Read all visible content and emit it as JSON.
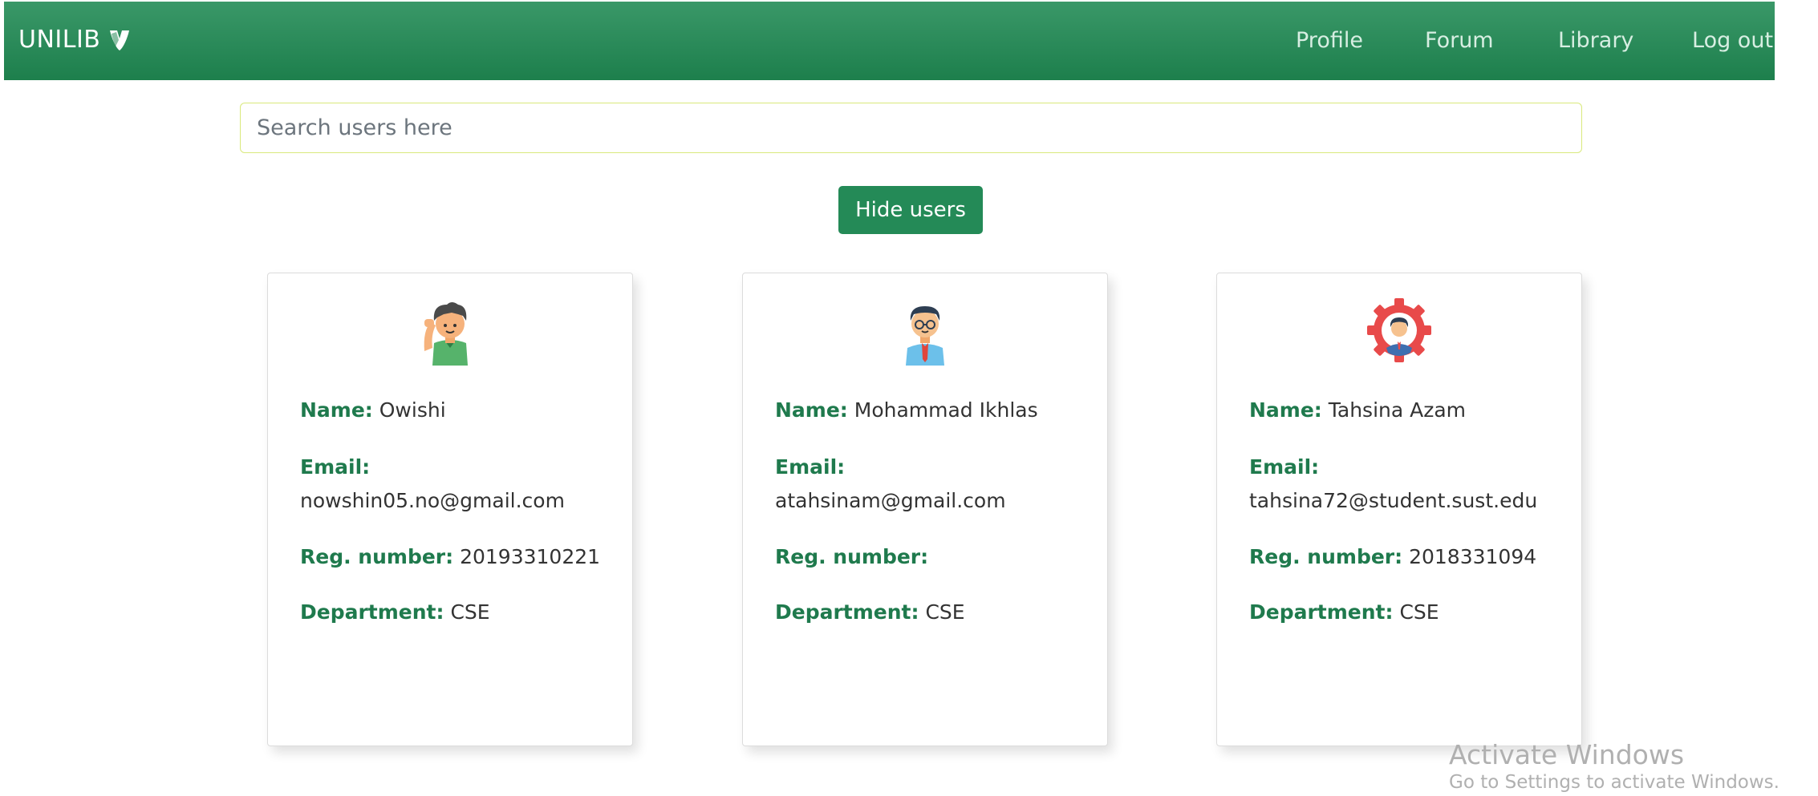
{
  "brand": {
    "name": "UNILIB",
    "logo_icon": "typo3-logo-icon"
  },
  "nav": [
    {
      "label": "Profile"
    },
    {
      "label": "Forum"
    },
    {
      "label": "Library"
    },
    {
      "label": "Log out"
    }
  ],
  "search": {
    "placeholder": "Search users here",
    "value": ""
  },
  "hide_button": {
    "label": "Hide users"
  },
  "field_labels": {
    "name": "Name:",
    "email": "Email:",
    "reg": "Reg. number:",
    "dept": "Department:"
  },
  "users": [
    {
      "avatar_icon": "waving-boy-avatar-icon",
      "name": "Owishi",
      "email": "nowshin05.no@gmail.com",
      "reg_number": "20193310221",
      "department": "CSE"
    },
    {
      "avatar_icon": "glasses-man-avatar-icon",
      "name": "Mohammad Ikhlas",
      "email": "atahsinam@gmail.com",
      "reg_number": "",
      "department": "CSE"
    },
    {
      "avatar_icon": "gear-person-avatar-icon",
      "name": "Tahsina Azam",
      "email": "tahsina72@student.sust.edu",
      "reg_number": "2018331094",
      "department": "CSE"
    }
  ],
  "watermark": {
    "title": "Activate Windows",
    "subtitle": "Go to Settings to activate Windows."
  },
  "colors": {
    "navbar": "#2a8a59",
    "button": "#248a57",
    "label": "#1f7a4d",
    "search_border": "#d9e97c"
  }
}
